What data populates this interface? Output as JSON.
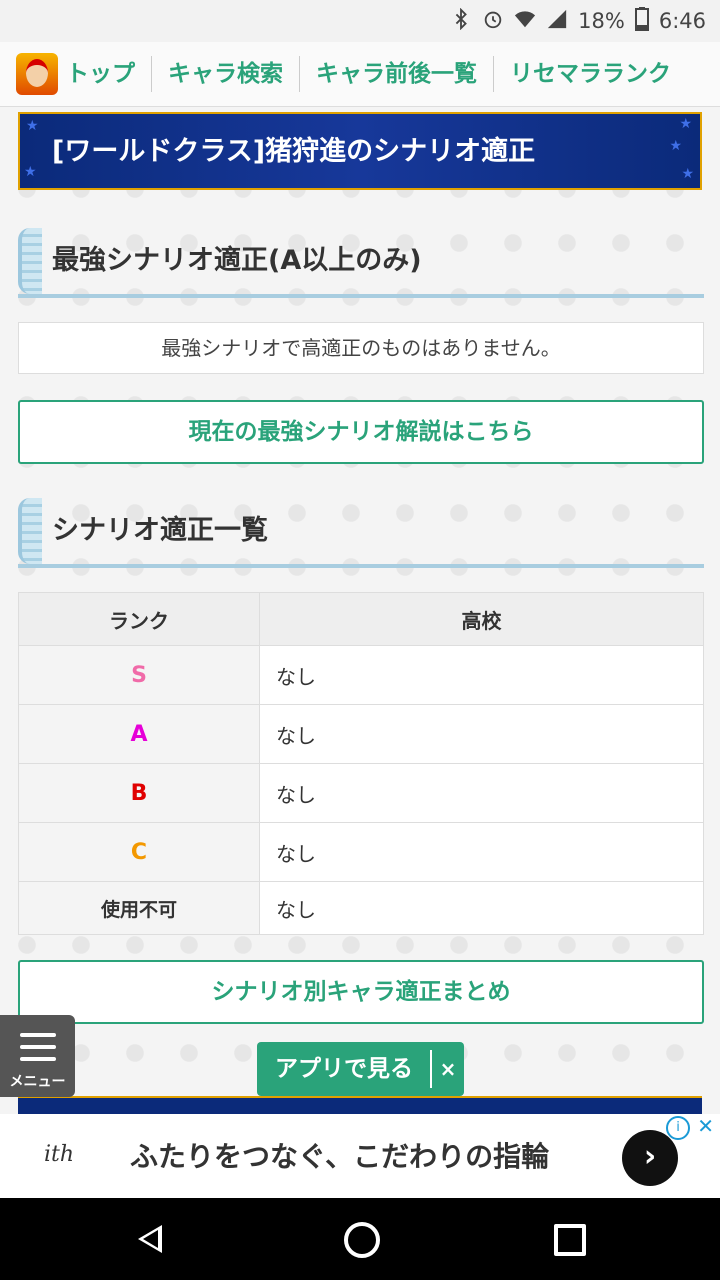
{
  "status_bar": {
    "battery": "18%",
    "time": "6:46"
  },
  "nav": {
    "items": [
      "トップ",
      "キャラ検索",
      "キャラ前後一覧",
      "リセマラランク"
    ]
  },
  "banner": {
    "title": "[ワールドクラス]猪狩進のシナリオ適正"
  },
  "section1": {
    "title": "最強シナリオ適正(A以上のみ)",
    "notice": "最強シナリオで高適正のものはありません。"
  },
  "link1": {
    "label": "現在の最強シナリオ解説はこちら"
  },
  "section2": {
    "title": "シナリオ適正一覧"
  },
  "table": {
    "headers": [
      "ランク",
      "高校"
    ],
    "rows": [
      {
        "rank": "S",
        "value": "なし",
        "color": "#f06aa8"
      },
      {
        "rank": "A",
        "value": "なし",
        "color": "#e600d8"
      },
      {
        "rank": "B",
        "value": "なし",
        "color": "#e00000"
      },
      {
        "rank": "C",
        "value": "なし",
        "color": "#f39800"
      },
      {
        "rank": "使用不可",
        "value": "なし",
        "color": "#333333"
      }
    ]
  },
  "link2": {
    "label": "シナリオ別キャラ適正まとめ"
  },
  "menu": {
    "label": "メニュー"
  },
  "app_button": {
    "label": "アプリで見る",
    "close": "×"
  },
  "ad": {
    "logo": "ith",
    "text": "ふたりをつなぐ、こだわりの指輪"
  }
}
